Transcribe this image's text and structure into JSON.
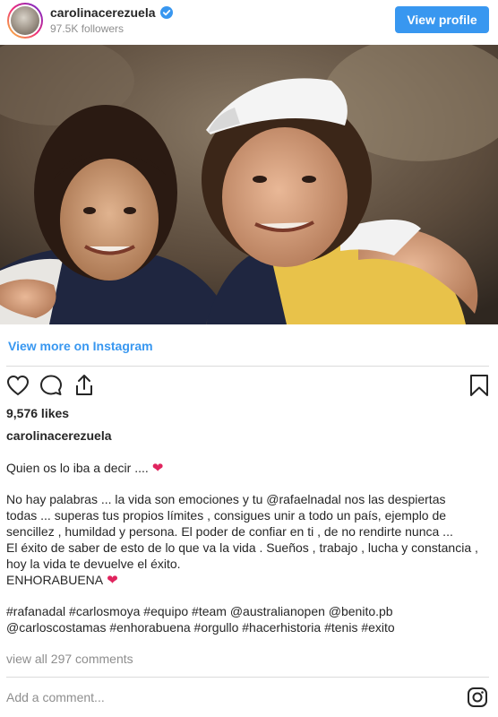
{
  "header": {
    "username": "carolinacerezuela",
    "followers": "97.5K followers",
    "view_profile_label": "View profile"
  },
  "post": {
    "view_more_label": "View more on Instagram",
    "likes": "9,576 likes",
    "caption_user": "carolinacerezuela",
    "caption_lines": [
      "Quien os lo iba a decir ....",
      "No hay palabras ... la vida son emociones y tu @rafaelnadal nos las despiertas",
      "todas ... superas tus propios límites , consigues unir a todo un país, ejemplo de",
      "sencillez , humildad y persona. El poder de confiar en ti , de no rendirte nunca ...",
      "El éxito de saber de esto de lo que va la vida . Sueños , trabajo , lucha y constancia ,",
      "hoy la vida te devuelve el éxito.",
      "ENHORABUENA",
      "#rafanadal #carlosmoya #equipo #team @australianopen @benito.pb",
      "@carloscostamas #enhorabuena #orgullo #hacerhistoria #tenis #exito"
    ],
    "view_comments": "view all 297 comments",
    "add_comment_placeholder": "Add a comment..."
  },
  "colors": {
    "accent": "#3897f0",
    "heart": "#e0245e",
    "muted": "#8e8e8e"
  },
  "icons": [
    "verified-badge-icon",
    "heart-icon",
    "comment-icon",
    "share-icon",
    "bookmark-icon",
    "instagram-icon"
  ]
}
